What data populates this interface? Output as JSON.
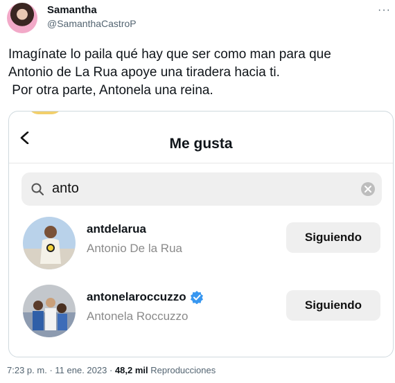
{
  "tweet": {
    "author_name": "Samantha",
    "author_handle": "@SamanthaCastroP",
    "more_label": "···",
    "text": "Imagínate lo paila qué hay que ser como man para que\nAntonio de La Rua apoye una tiradera hacia ti.\n Por otra parte, Antonela una reina.",
    "time": "7:23 p. m.",
    "date": "11 ene. 2023",
    "separator": "·",
    "views_count": "48,2 mil",
    "views_label": "Reproducciones"
  },
  "screenshot": {
    "title": "Me gusta",
    "search_value": "anto",
    "users": [
      {
        "username": "antdelarua",
        "full_name": "Antonio De la Rua",
        "verified": false,
        "button_label": "Siguiendo"
      },
      {
        "username": "antonelaroccuzzo",
        "full_name": "Antonela Roccuzzo",
        "verified": true,
        "button_label": "Siguiendo"
      }
    ]
  },
  "colors": {
    "verified_badge": "#3897f0",
    "secondary_text": "#536471"
  }
}
